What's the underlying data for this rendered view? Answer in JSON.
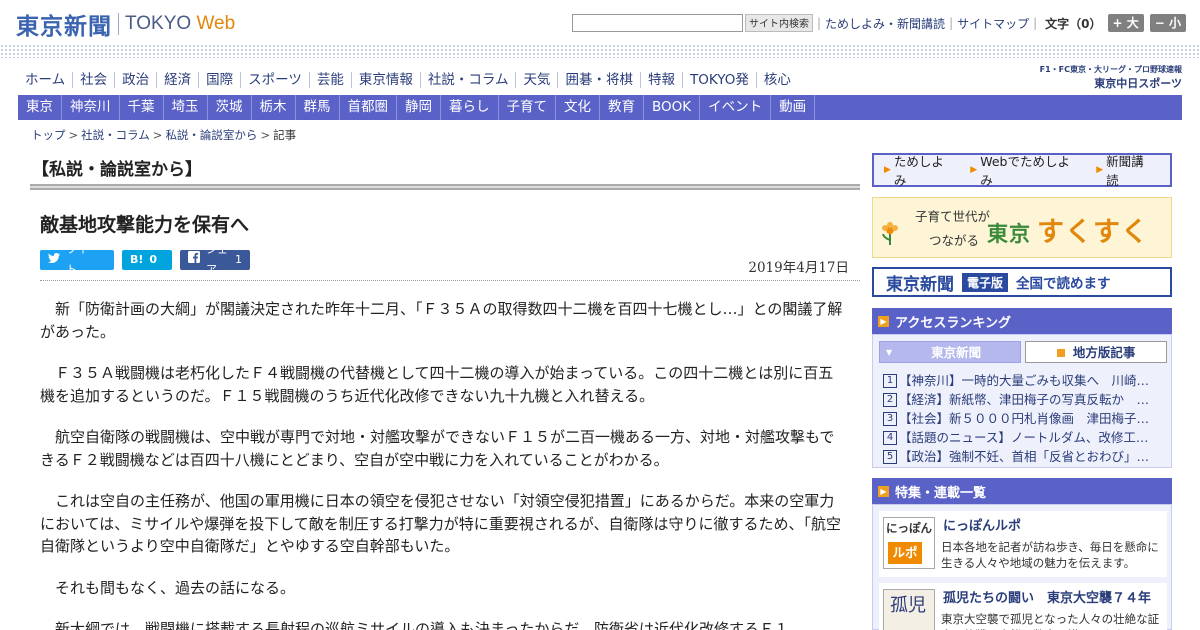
{
  "header": {
    "logo_jp": "東京新聞",
    "logo_en_main": "TOKYO",
    "logo_en_web": "Web",
    "search_placeholder": "",
    "search_button": "サイト内検索",
    "links": [
      "ためしよみ・新聞講読",
      "サイトマップ"
    ],
    "font_size_label": "文字（0）",
    "font_bigger": "+ 大",
    "font_smaller": "− 小"
  },
  "main_nav": [
    "ホーム",
    "社会",
    "政治",
    "経済",
    "国際",
    "スポーツ",
    "芸能",
    "東京情報",
    "社説・コラム",
    "天気",
    "囲碁・将棋",
    "特報",
    "TOKYO発",
    "核心"
  ],
  "chunichi": {
    "line1": "F1・FC東京・大リーグ・プロ野球速報",
    "line2": "東京中日スポーツ"
  },
  "sub_nav": [
    "東京",
    "神奈川",
    "千葉",
    "埼玉",
    "茨城",
    "栃木",
    "群馬",
    "首都圏",
    "静岡",
    "暮らし",
    "子育て",
    "文化",
    "教育",
    "BOOK",
    "イベント",
    "動画"
  ],
  "breadcrumb": [
    "トップ",
    "社説・コラム",
    "私説・論説室から",
    "記事"
  ],
  "article": {
    "section": "【私説・論説室から】",
    "headline": "敵基地攻撃能力を保有へ",
    "date": "2019年4月17日",
    "share": {
      "tweet": "ツイート",
      "hatena_count": "0",
      "fb_label": "シェア",
      "fb_count": "1"
    },
    "paragraphs": [
      "新「防衛計画の大綱」が閣議決定された昨年十二月、「Ｆ３５Ａの取得数四十二機を百四十七機とし…」との閣議了解があった。",
      "Ｆ３５Ａ戦闘機は老朽化したＦ４戦闘機の代替機として四十二機の導入が始まっている。この四十二機とは別に百五機を追加するというのだ。Ｆ１５戦闘機のうち近代化改修できない九十九機と入れ替える。",
      "航空自衛隊の戦闘機は、空中戦が専門で対地・対艦攻撃ができないＦ１５が二百一機ある一方、対地・対艦攻撃もできるＦ２戦闘機などは百四十八機にとどまり、空自が空中戦に力を入れていることがわかる。",
      "これは空自の主任務が、他国の軍用機に日本の領空を侵犯させない「対領空侵犯措置」にあるからだ。本来の空軍力においては、ミサイルや爆弾を投下して敵を制圧する打撃力が特に重要視されるが、自衛隊は守りに徹するため、「航空自衛隊というより空中自衛隊だ」とやゆする空自幹部もいた。",
      "それも間もなく、過去の話になる。",
      "新大綱では、戦闘機に搭載する長射程の巡航ミサイルの導入も決まったからだ。防衛省は近代化改修するＦ１"
    ]
  },
  "sidebar": {
    "sub_links": [
      "ためしよみ",
      "Webでためしよみ",
      "新聞講読"
    ],
    "sukusuku": {
      "tagline1": "子育て世代が",
      "tagline2": "つながる",
      "title_pre": "東京",
      "title": "すくすく"
    },
    "denshi": {
      "brand": "東京新聞",
      "badge": "電子版",
      "text": "全国で読めます"
    },
    "ranking": {
      "head": "アクセスランキング",
      "tab_active": "東京新聞",
      "tab_inactive": "地方版記事",
      "items": [
        {
          "num": "1",
          "text": "【神奈川】一時的大量ごみも収集へ　川崎…"
        },
        {
          "num": "2",
          "text": "【経済】新紙幣、津田梅子の写真反転か　…"
        },
        {
          "num": "3",
          "text": "【社会】新５０００円札肖像画　津田梅子…"
        },
        {
          "num": "4",
          "text": "【話題のニュース】ノートルダム、改修工…"
        },
        {
          "num": "5",
          "text": "【政治】強制不妊、首相「反省とおわび」…"
        }
      ]
    },
    "features": {
      "head": "特集・連載一覧",
      "items": [
        {
          "title": "にっぽんルポ",
          "desc": "日本各地を記者が訪ね歩き、毎日を懸命に生きる人々や地域の魅力を伝えます。",
          "thumb_top": "にっぽん",
          "thumb_bottom": "ルポ"
        },
        {
          "title": "孤児たちの闘い　東京大空襲７４年",
          "desc": "東京大空襲で孤児となった人々の壮絶な証言、終戦と実態の数字で描いてきます。",
          "thumb_glyph": "孤児"
        }
      ]
    }
  },
  "colors": {
    "nav_blue": "#5a62c8",
    "link_navy": "#2a3d7a",
    "accent_orange": "#f08a00",
    "tweet": "#1da1f2",
    "hatena": "#00a4de",
    "facebook": "#3b5998"
  }
}
